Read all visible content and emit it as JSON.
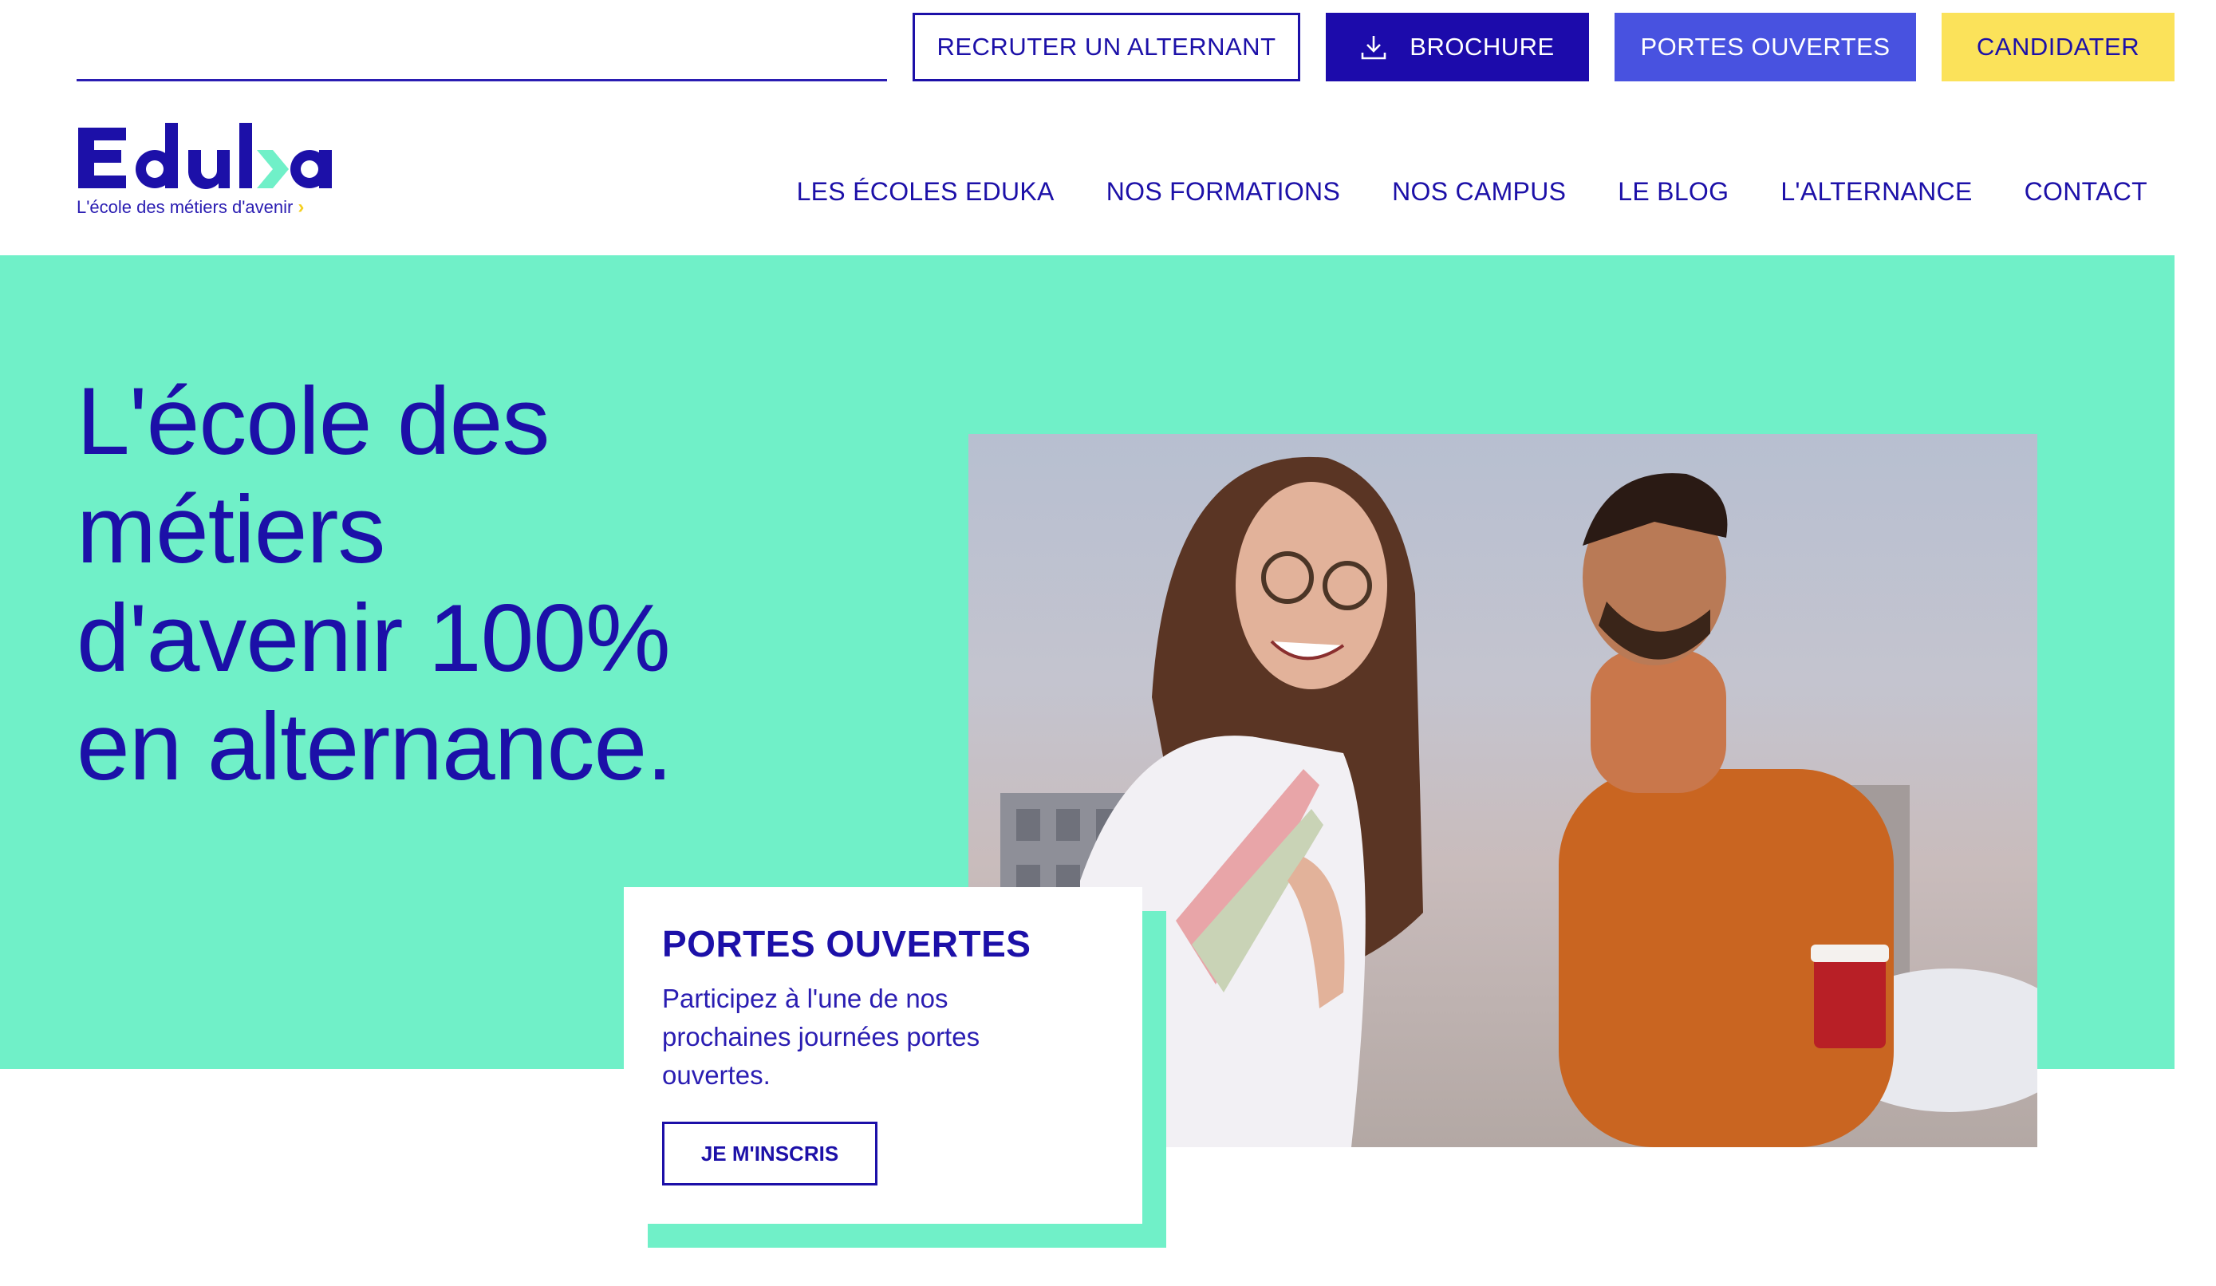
{
  "colors": {
    "brand_navy": "#1c10a8",
    "mint": "#70f0c8",
    "periwinkle": "#4852e0",
    "yellow": "#fbe25a"
  },
  "topbar": {
    "recruter_label": "RECRUTER UN ALTERNANT",
    "brochure_label": "BROCHURE",
    "brochure_icon": "download-icon",
    "portes_label": "PORTES OUVERTES",
    "candidater_label": "CANDIDATER"
  },
  "logo": {
    "wordmark": "Eduka",
    "tagline": "L'école des métiers d'avenir",
    "tagline_icon": "chevron-right-icon"
  },
  "nav": {
    "items": [
      {
        "label": "LES ÉCOLES EDUKA"
      },
      {
        "label": "NOS FORMATIONS"
      },
      {
        "label": "NOS CAMPUS"
      },
      {
        "label": "LE BLOG"
      },
      {
        "label": "L'ALTERNANCE"
      },
      {
        "label": "CONTACT"
      }
    ]
  },
  "hero": {
    "title_lines": [
      "L'école des",
      "métiers",
      "d'avenir 100%",
      "en alternance."
    ]
  },
  "card": {
    "title": "PORTES OUVERTES",
    "text": "Participez à l'une de nos prochaines journées portes ouvertes.",
    "button_label": "JE M'INSCRIS"
  }
}
